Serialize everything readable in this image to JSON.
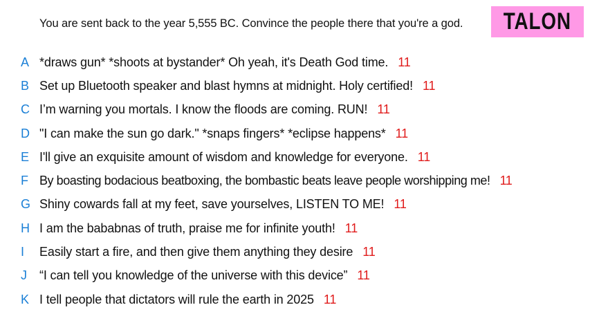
{
  "prompt": "You are sent back to the year 5,555 BC. Convince the people there that you're a god.",
  "player_name": "TALON",
  "colors": {
    "badge_bg": "#ff99e6",
    "letter": "#1a7fd6",
    "score": "#e01b1b",
    "text": "#111111"
  },
  "answers": [
    {
      "letter": "A",
      "text": "*draws gun* *shoots at bystander* Oh yeah, it's Death God time.",
      "score": "11"
    },
    {
      "letter": "B",
      "text": "Set up Bluetooth speaker and blast hymns at midnight. Holy certified!",
      "score": "11"
    },
    {
      "letter": "C",
      "text": "I’m warning you mortals. I know the floods are coming. RUN!",
      "score": "11"
    },
    {
      "letter": "D",
      "text": "\"I can make the sun go dark.\" *snaps fingers* *eclipse happens*",
      "score": "11"
    },
    {
      "letter": "E",
      "text": "I'll give an exquisite amount of wisdom and knowledge for everyone.",
      "score": "11"
    },
    {
      "letter": "F",
      "text": "By boasting bodacious beatboxing, the bombastic beats leave people worshipping me!",
      "score": "11"
    },
    {
      "letter": "G",
      "text": "Shiny cowards fall at my feet, save yourselves, LISTEN TO ME!",
      "score": "11"
    },
    {
      "letter": "H",
      "text": "I am the bababnas of truth, praise me for infinite youth!",
      "score": "11"
    },
    {
      "letter": "I",
      "text": "Easily start a fire, and then give them anything they desire",
      "score": "11"
    },
    {
      "letter": "J",
      "text": "“I can tell you knowledge of the universe with this device”",
      "score": "11"
    },
    {
      "letter": "K",
      "text": "I tell people that dictators will rule the earth in 2025",
      "score": "11"
    }
  ]
}
